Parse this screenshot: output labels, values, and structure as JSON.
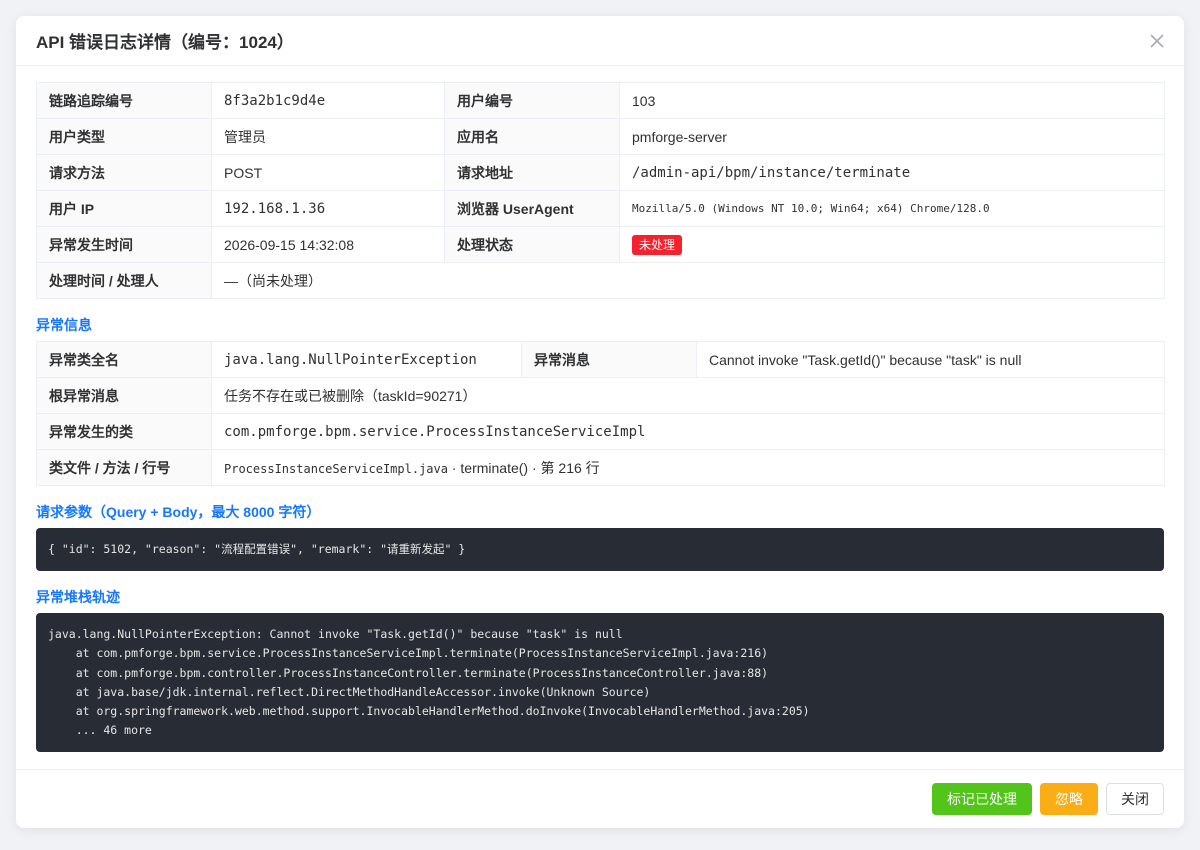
{
  "dialog": {
    "title": "API 错误日志详情（编号：1024）",
    "close_icon": "close-icon"
  },
  "basic": {
    "rows": [
      {
        "l1": "链路追踪编号",
        "v1": "8f3a2b1c9d4e",
        "l2": "用户编号",
        "v2": "103"
      },
      {
        "l1": "用户类型",
        "v1": "管理员",
        "l2": "应用名",
        "v2": "pmforge-server"
      },
      {
        "l1": "请求方法",
        "v1": "POST",
        "l2": "请求地址",
        "v2": "/admin-api/bpm/instance/terminate"
      },
      {
        "l1": "用户 IP",
        "v1": "192.168.1.36",
        "l2": "浏览器 UserAgent",
        "v2": "Mozilla/5.0 (Windows NT 10.0; Win64; x64) Chrome/128.0"
      },
      {
        "l1": "异常发生时间",
        "v1": "2026-09-15 14:32:08",
        "l2": "处理状态",
        "v2": "未处理"
      }
    ],
    "handle_label": "处理时间 / 处理人",
    "handle_value": "—（尚未处理）"
  },
  "exception": {
    "section_title": "异常信息",
    "class_label": "异常类全名",
    "class_value": "java.lang.NullPointerException",
    "message_label": "异常消息",
    "message_value": "Cannot invoke \"Task.getId()\" because \"task\" is null",
    "root_label": "根异常消息",
    "root_value": "任务不存在或已被删除（taskId=90271）",
    "occur_class_label": "异常发生的类",
    "occur_class_value": "com.pmforge.bpm.service.ProcessInstanceServiceImpl",
    "file_label": "类文件 / 方法 / 行号",
    "file_name": "ProcessInstanceServiceImpl.java",
    "file_rest": " · terminate() · 第 216 行"
  },
  "params": {
    "section_title": "请求参数（Query + Body，最大 8000 字符）",
    "content": "{ \"id\": 5102, \"reason\": \"流程配置错误\", \"remark\": \"请重新发起\" }"
  },
  "stack": {
    "section_title": "异常堆栈轨迹",
    "content": "java.lang.NullPointerException: Cannot invoke \"Task.getId()\" because \"task\" is null\n    at com.pmforge.bpm.service.ProcessInstanceServiceImpl.terminate(ProcessInstanceServiceImpl.java:216)\n    at com.pmforge.bpm.controller.ProcessInstanceController.terminate(ProcessInstanceController.java:88)\n    at java.base/jdk.internal.reflect.DirectMethodHandleAccessor.invoke(Unknown Source)\n    at org.springframework.web.method.support.InvocableHandlerMethod.doInvoke(InvocableHandlerMethod.java:205)\n    ... 46 more"
  },
  "footer": {
    "mark_handled": "标记已处理",
    "ignore": "忽略",
    "close": "关闭"
  },
  "colors": {
    "accent": "#1677ff",
    "success": "#52c41a",
    "warning": "#faad14",
    "danger": "#f5222d",
    "code_bg": "#282c34"
  }
}
